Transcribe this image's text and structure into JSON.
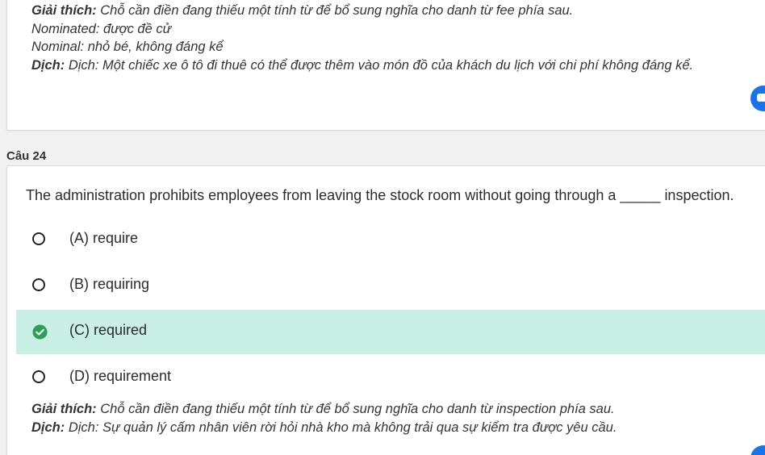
{
  "prev_question": {
    "explanation_label": "Giải thích:",
    "explanation": " Chỗ cần điền đang thiếu một tính từ để bổ sung nghĩa cho danh từ fee phía sau.",
    "note1": "Nominated: được đề cử",
    "note2": "Nominal: nhỏ bé, không đáng kể",
    "translation_label": "Dịch:",
    "translation": " Dịch: Một chiếc xe ô tô đi thuê có thể được thêm vào món đồ của khách du lịch với chi phí không đáng kể."
  },
  "question": {
    "label": "Câu 24",
    "text": "The administration prohibits employees from leaving the stock room without going through a _____ inspection.",
    "options": [
      {
        "label": "(A) require",
        "selected": false
      },
      {
        "label": "(B) requiring",
        "selected": false
      },
      {
        "label": "(C) required",
        "selected": true
      },
      {
        "label": "(D) requirement",
        "selected": false
      }
    ],
    "explanation_label": "Giải thích:",
    "explanation": " Chỗ cần điền đang thiếu một tính từ để bổ sung nghĩa cho danh từ inspection phía sau.",
    "translation_label": "Dịch:",
    "translation": " Dịch: Sự quản lý cấm nhân viên rời hỏi nhà kho mà không trải qua sự kiểm tra được yêu cầu."
  },
  "colors": {
    "selected_bg": "#c9eee4",
    "check_green": "#2e9e5b",
    "chat_blue": "#1a73e8"
  },
  "icons": {
    "chat": "chat-bubble-icon",
    "check": "check-circle-icon",
    "radio": "radio-empty-icon"
  }
}
